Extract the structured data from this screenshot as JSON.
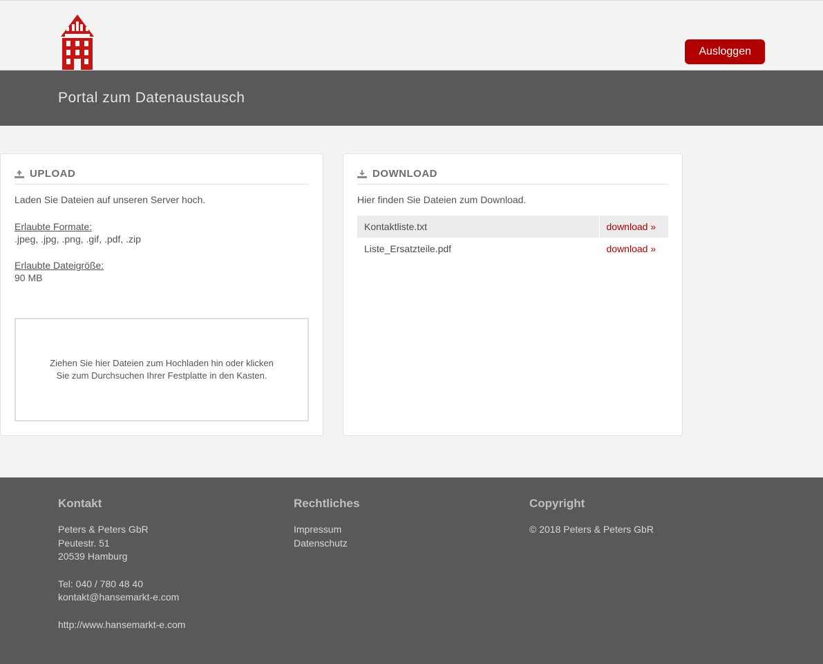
{
  "header": {
    "logout_label": "Ausloggen"
  },
  "title": "Portal zum Datenaustausch",
  "upload": {
    "heading": "UPLOAD",
    "intro": "Laden Sie Dateien auf unseren Server hoch.",
    "formats_label": "Erlaubte Formate:",
    "formats_value": ".jpeg, .jpg, .png, .gif, .pdf, .zip",
    "size_label": "Erlaubte Dateigröße:",
    "size_value": "90 MB",
    "dropzone_text": "Ziehen Sie hier Dateien zum Hochladen hin oder klicken Sie zum Durchsuchen Ihrer Festplatte in den Kasten."
  },
  "download": {
    "heading": "DOWNLOAD",
    "intro": "Hier finden Sie Dateien zum Download.",
    "link_label": "download »",
    "files": [
      {
        "name": "Kontaktliste.txt"
      },
      {
        "name": "Liste_Ersatzteile.pdf"
      }
    ]
  },
  "footer": {
    "contact": {
      "heading": "Kontakt",
      "company": "Peters & Peters GbR",
      "street": "Peutestr. 51",
      "city": "20539 Hamburg",
      "tel": "Tel: 040 / 780 48 40",
      "email": "kontakt@hansemarkt-e.com",
      "website": "http://www.hansemarkt-e.com"
    },
    "legal": {
      "heading": "Rechtliches",
      "impressum": "Impressum",
      "datenschutz": "Datenschutz"
    },
    "copyright": {
      "heading": "Copyright",
      "text": "© 2018 Peters & Peters GbR"
    }
  }
}
